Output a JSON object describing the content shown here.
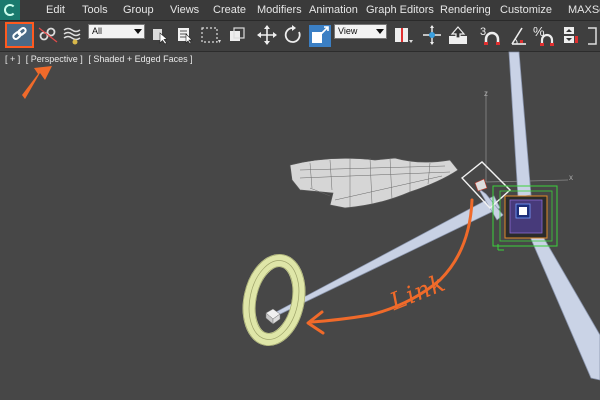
{
  "menu": {
    "items": [
      "Edit",
      "Tools",
      "Group",
      "Views",
      "Create",
      "Modifiers",
      "Animation",
      "Graph Editors",
      "Rendering",
      "Customize",
      "MAXScr"
    ]
  },
  "toolbar": {
    "selection_filter": "All",
    "reference_coord": "View",
    "snap_angle_label": "3",
    "percent_label": "%"
  },
  "viewport": {
    "label_plus": "[ + ]",
    "label_view": "[ Perspective ]",
    "label_shading": "[ Shaded + Edged Faces ]",
    "axis_label": "z",
    "axis_label_x": "x"
  },
  "annotation": {
    "text": "Link",
    "color": "#f06a2a"
  },
  "colors": {
    "highlight": "#ff5a1f",
    "background": "#474747",
    "torus": "#e8ecb0",
    "bounding_box": "#3bd13b"
  }
}
